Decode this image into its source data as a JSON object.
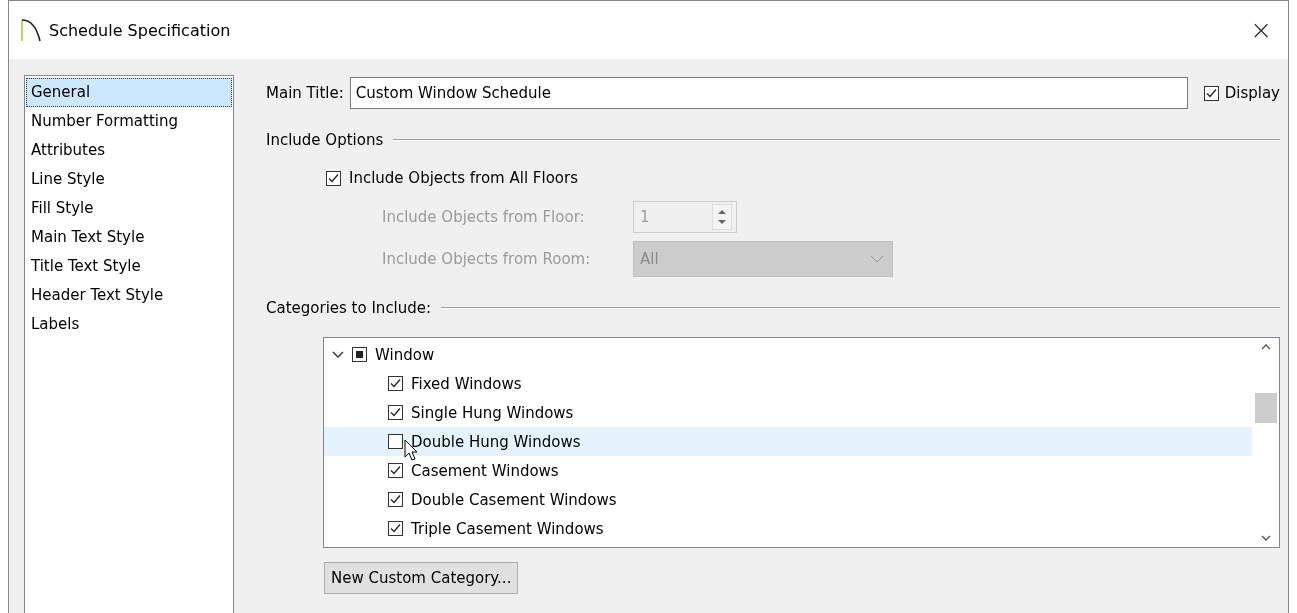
{
  "window": {
    "title": "Schedule Specification",
    "close": "×"
  },
  "sidebar": {
    "items": [
      {
        "label": "General",
        "selected": true
      },
      {
        "label": "Number Formatting",
        "selected": false
      },
      {
        "label": "Attributes",
        "selected": false
      },
      {
        "label": "Line Style",
        "selected": false
      },
      {
        "label": "Fill Style",
        "selected": false
      },
      {
        "label": "Main Text Style",
        "selected": false
      },
      {
        "label": "Title Text Style",
        "selected": false
      },
      {
        "label": "Header Text Style",
        "selected": false
      },
      {
        "label": "Labels",
        "selected": false
      }
    ]
  },
  "main_title": {
    "label": "Main Title:",
    "value": "Custom Window Schedule",
    "display": {
      "label": "Display",
      "checked": true
    }
  },
  "include_options": {
    "heading": "Include Options",
    "all_floors": {
      "label": "Include Objects from All Floors",
      "checked": true
    },
    "floor": {
      "label": "Include Objects from Floor:",
      "value": "1",
      "disabled": true
    },
    "room": {
      "label": "Include Objects from Room:",
      "value": "All",
      "disabled": true
    }
  },
  "categories": {
    "heading": "Categories to Include:",
    "tree": [
      {
        "label": "Window",
        "expanded": true,
        "checked": false,
        "partial": true,
        "children": [
          {
            "label": "Fixed Windows",
            "checked": true,
            "selected": false
          },
          {
            "label": "Single Hung Windows",
            "checked": true,
            "selected": false
          },
          {
            "label": "Double Hung Windows",
            "checked": false,
            "selected": true
          },
          {
            "label": "Casement Windows",
            "checked": true,
            "selected": false
          },
          {
            "label": "Double Casement Windows",
            "checked": true,
            "selected": false
          },
          {
            "label": "Triple Casement Windows",
            "checked": true,
            "selected": false
          }
        ]
      }
    ],
    "new_button": "New Custom Category..."
  }
}
